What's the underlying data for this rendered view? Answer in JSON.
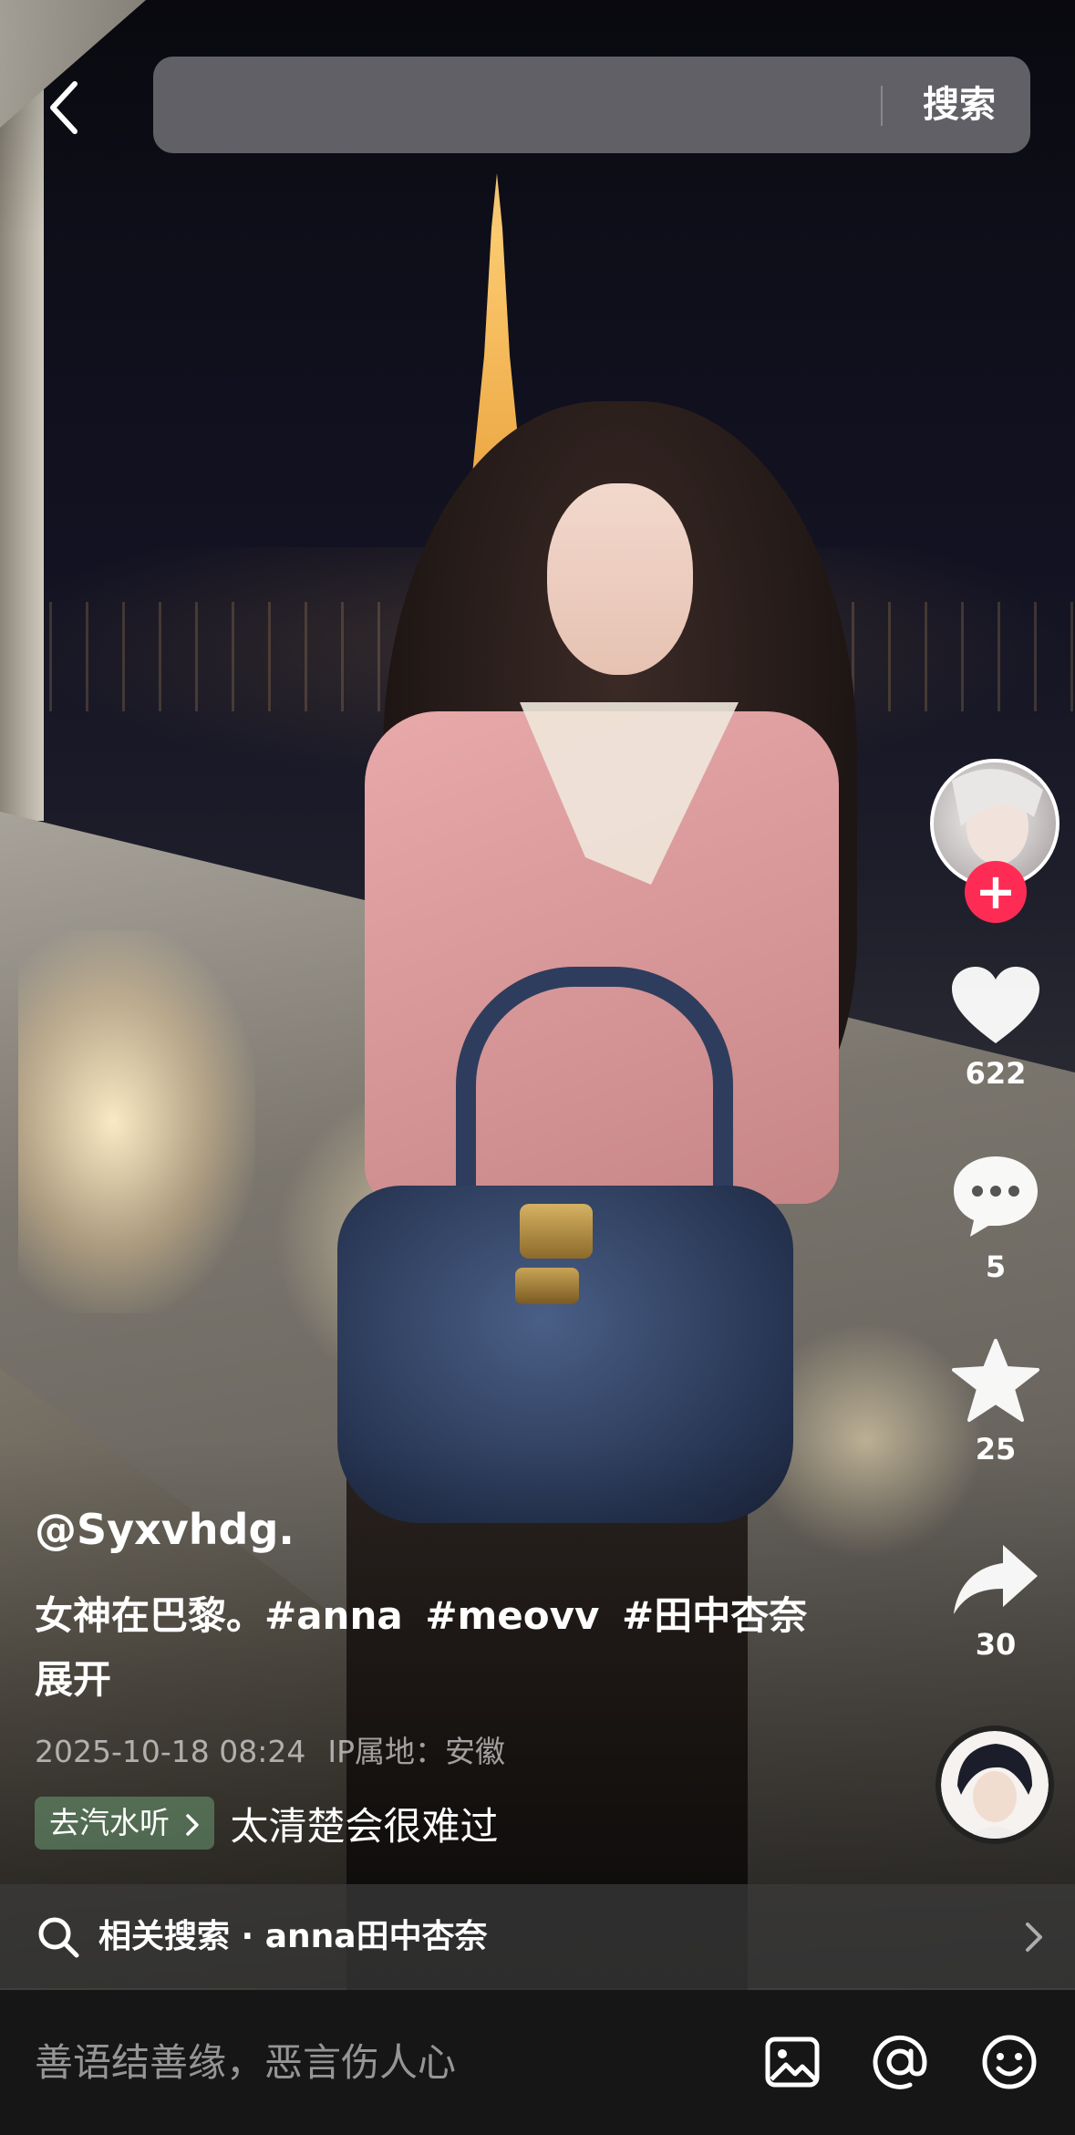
{
  "topbar": {
    "search_button": "搜索"
  },
  "post": {
    "author": "@Syxvhdg.",
    "caption_text": "女神在巴黎。",
    "hashtags": [
      "#anna",
      "#meovv",
      "#田中杏奈"
    ],
    "expand_label": "展开",
    "timestamp": "2025-10-18 08:24",
    "ip_location": "IP属地：安徽",
    "music_tag": "去汽水听",
    "music_title": "太清楚会很难过"
  },
  "actions": {
    "likes": "622",
    "comments": "5",
    "favorites": "25",
    "shares": "30"
  },
  "related_search": {
    "label": "相关搜索 · anna田中杏奈"
  },
  "comment_bar": {
    "placeholder": "善语结善缘，恶言伤人心"
  },
  "colors": {
    "follow_badge": "#fe2c55",
    "bottom_bar": "#161616",
    "music_tag": "#78b482"
  },
  "icons": [
    "back-icon",
    "search-icon",
    "heart-icon",
    "comment-icon",
    "star-icon",
    "share-icon",
    "image-icon",
    "at-icon",
    "emoji-icon",
    "chevron-right-icon"
  ]
}
